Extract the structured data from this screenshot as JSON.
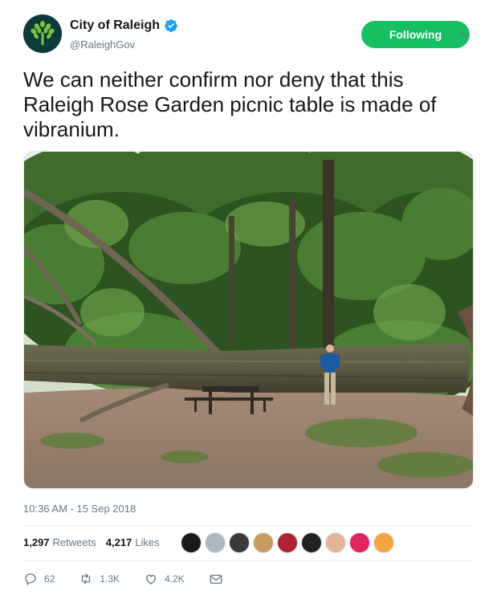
{
  "account": {
    "display_name": "City of Raleigh",
    "handle": "@RaleighGov",
    "verified": true,
    "avatar_icon": "oak-tree-logo-icon"
  },
  "follow_button": {
    "label": "Following",
    "color": "#17bf63"
  },
  "tweet": {
    "text": "We can neither confirm nor deny that this Raleigh Rose Garden picnic table is made of vibranium.",
    "timestamp": "10:36 AM - 15 Sep 2018"
  },
  "stats": {
    "retweets_count": "1,297",
    "retweets_label": "Retweets",
    "likes_count": "4,217",
    "likes_label": "Likes"
  },
  "likers": [
    {
      "icon": "avatar-icon",
      "color": "#1a1a1a"
    },
    {
      "icon": "avatar-icon",
      "color": "#aab8c2"
    },
    {
      "icon": "avatar-icon",
      "color": "#3a3a3a"
    },
    {
      "icon": "avatar-icon",
      "color": "#c89b5e"
    },
    {
      "icon": "avatar-icon",
      "color": "#b22234"
    },
    {
      "icon": "avatar-icon",
      "color": "#222222"
    },
    {
      "icon": "avatar-icon",
      "color": "#e3b49a"
    },
    {
      "icon": "avatar-icon",
      "color": "#e0245e"
    },
    {
      "icon": "avatar-icon",
      "color": "#f4a442"
    }
  ],
  "actions": {
    "reply_count": "62",
    "retweet_count": "1.3K",
    "like_count": "4.2K"
  }
}
